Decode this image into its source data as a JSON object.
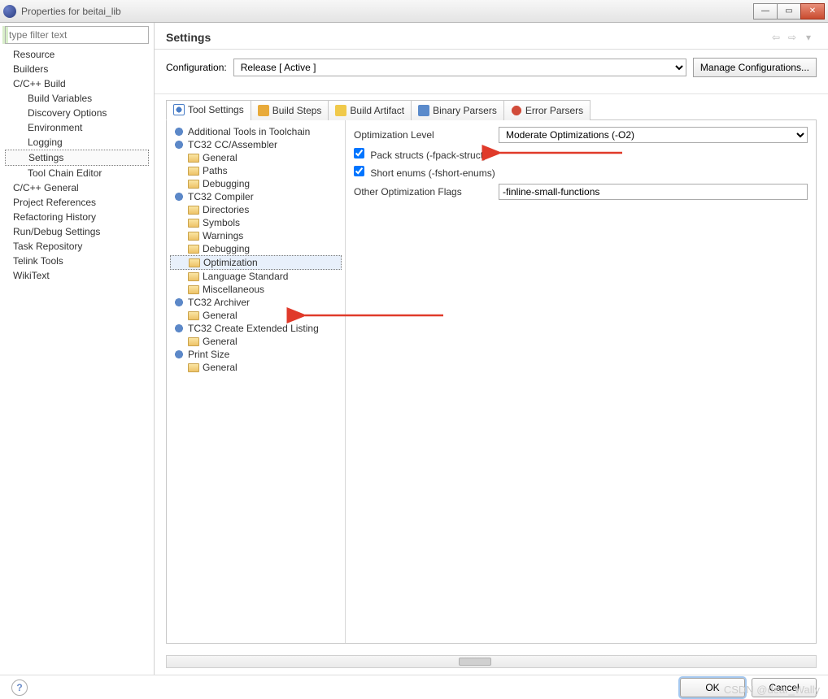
{
  "window": {
    "title": "Properties for beitai_lib"
  },
  "filter_placeholder": "type filter text",
  "nav": [
    {
      "label": "Resource",
      "lvl": 1
    },
    {
      "label": "Builders",
      "lvl": 1
    },
    {
      "label": "C/C++ Build",
      "lvl": 1
    },
    {
      "label": "Build Variables",
      "lvl": 2
    },
    {
      "label": "Discovery Options",
      "lvl": 2
    },
    {
      "label": "Environment",
      "lvl": 2
    },
    {
      "label": "Logging",
      "lvl": 2
    },
    {
      "label": "Settings",
      "lvl": 2,
      "sel": true
    },
    {
      "label": "Tool Chain Editor",
      "lvl": 2
    },
    {
      "label": "C/C++ General",
      "lvl": 1
    },
    {
      "label": "Project References",
      "lvl": 1
    },
    {
      "label": "Refactoring History",
      "lvl": 1
    },
    {
      "label": "Run/Debug Settings",
      "lvl": 1
    },
    {
      "label": "Task Repository",
      "lvl": 1
    },
    {
      "label": "Telink Tools",
      "lvl": 1
    },
    {
      "label": "WikiText",
      "lvl": 1
    }
  ],
  "header": {
    "title": "Settings"
  },
  "config": {
    "label": "Configuration:",
    "value": "Release  [ Active ]",
    "manage_btn": "Manage Configurations..."
  },
  "tabs": [
    {
      "label": "Tool Settings",
      "icon": "tools",
      "active": true
    },
    {
      "label": "Build Steps",
      "icon": "steps"
    },
    {
      "label": "Build Artifact",
      "icon": "art"
    },
    {
      "label": "Binary Parsers",
      "icon": "bin"
    },
    {
      "label": "Error Parsers",
      "icon": "err"
    }
  ],
  "tree": [
    {
      "label": "Additional Tools in Toolchain",
      "lvl": 1,
      "icon": "gear"
    },
    {
      "label": "TC32 CC/Assembler",
      "lvl": 1,
      "icon": "gear"
    },
    {
      "label": "General",
      "lvl": 2,
      "icon": "folder"
    },
    {
      "label": "Paths",
      "lvl": 2,
      "icon": "folder"
    },
    {
      "label": "Debugging",
      "lvl": 2,
      "icon": "folder"
    },
    {
      "label": "TC32 Compiler",
      "lvl": 1,
      "icon": "gear"
    },
    {
      "label": "Directories",
      "lvl": 2,
      "icon": "folder"
    },
    {
      "label": "Symbols",
      "lvl": 2,
      "icon": "folder"
    },
    {
      "label": "Warnings",
      "lvl": 2,
      "icon": "folder"
    },
    {
      "label": "Debugging",
      "lvl": 2,
      "icon": "folder"
    },
    {
      "label": "Optimization",
      "lvl": 2,
      "icon": "folder",
      "sel": true
    },
    {
      "label": "Language Standard",
      "lvl": 2,
      "icon": "folder"
    },
    {
      "label": "Miscellaneous",
      "lvl": 2,
      "icon": "folder"
    },
    {
      "label": "TC32 Archiver",
      "lvl": 1,
      "icon": "gear"
    },
    {
      "label": "General",
      "lvl": 2,
      "icon": "folder"
    },
    {
      "label": "TC32 Create Extended Listing",
      "lvl": 1,
      "icon": "gear"
    },
    {
      "label": "General",
      "lvl": 2,
      "icon": "folder"
    },
    {
      "label": "Print Size",
      "lvl": 1,
      "icon": "gear"
    },
    {
      "label": "General",
      "lvl": 2,
      "icon": "folder"
    }
  ],
  "form": {
    "opt_level_label": "Optimization Level",
    "opt_level_value": "Moderate Optimizations (-O2)",
    "pack_structs_label": "Pack structs (-fpack-struct)",
    "pack_structs_checked": true,
    "short_enums_label": "Short enums (-fshort-enums)",
    "short_enums_checked": true,
    "other_flags_label": "Other Optimization Flags",
    "other_flags_value": "-finline-small-functions"
  },
  "buttons": {
    "ok": "OK",
    "cancel": "Cancel"
  },
  "watermark": "CSDN @dear_Wally"
}
